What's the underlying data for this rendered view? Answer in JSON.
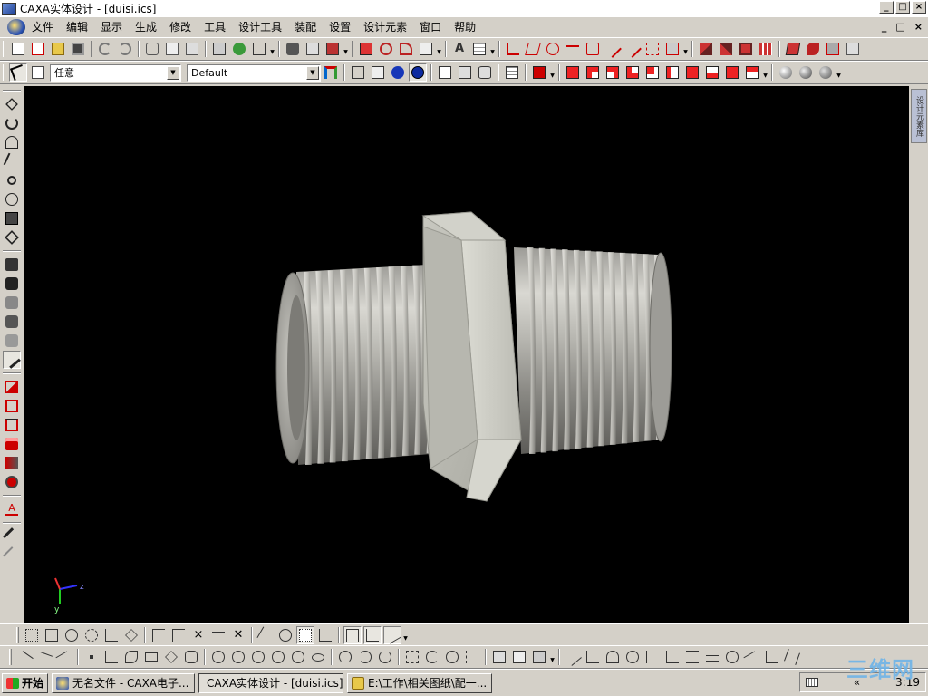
{
  "window": {
    "title": "CAXA实体设计 - [duisi.ics]",
    "caption_buttons": [
      "_",
      "□",
      "×"
    ]
  },
  "menu": {
    "items": [
      "文件",
      "编辑",
      "显示",
      "生成",
      "修改",
      "工具",
      "设计工具",
      "装配",
      "设置",
      "设计元素",
      "窗口",
      "帮助"
    ],
    "mdi_buttons": [
      "_",
      "□",
      "×"
    ]
  },
  "toolbar2": {
    "selection_filter": "任意",
    "render_style": "Default"
  },
  "design_panel": {
    "tab_label": "设计元素库"
  },
  "viewport": {
    "axis_label_z": "z",
    "axis_label_y": "y",
    "background": "#000000",
    "model_color": "#c9c8c2"
  },
  "taskbar": {
    "start_label": "开始",
    "tasks": [
      "无名文件 - CAXA电子...",
      "CAXA实体设计 - [duisi.ics]",
      "E:\\工作\\相关图纸\\配一..."
    ],
    "clock": "3:19",
    "tray_arrows": "«",
    "watermark": "三维网"
  }
}
